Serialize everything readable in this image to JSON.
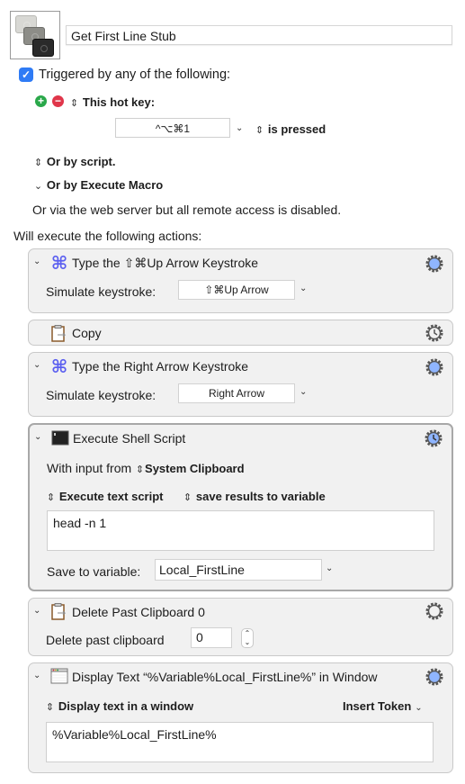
{
  "macro": {
    "icon": "keyboard-keys-icon",
    "name": "Get First Line Stub"
  },
  "trigger": {
    "checkbox_checked": true,
    "label": "Triggered by any of the following:",
    "hotkey_type": "This hot key:",
    "hotkey_value": "^⌥⌘1",
    "hotkey_condition": "is pressed",
    "or_by_script": "Or by script.",
    "or_by_execute_macro": "Or by Execute Macro",
    "web_server_note": "Or via the web server but all remote access is disabled."
  },
  "actions_heading": "Will execute the following actions:",
  "actions": [
    {
      "title": "Type the ⇧⌘Up Arrow Keystroke",
      "icon": "command-key-icon",
      "gear": "gear-blue-icon",
      "field_label": "Simulate keystroke:",
      "field_value": "⇧⌘Up Arrow"
    },
    {
      "title": "Copy",
      "icon": "clipboard-icon",
      "gear": "gear-clock-icon"
    },
    {
      "title": "Type the Right Arrow Keystroke",
      "icon": "command-key-icon",
      "gear": "gear-blue-icon",
      "field_label": "Simulate keystroke:",
      "field_value": "Right Arrow"
    },
    {
      "title": "Execute Shell Script",
      "icon": "terminal-icon",
      "gear": "gear-clock-blue-icon",
      "input_label": "With input from",
      "input_source": "System Clipboard",
      "script_mode": "Execute text script",
      "result_mode": "save results to variable",
      "script": "head -n 1",
      "save_label": "Save to variable:",
      "save_variable": "Local_FirstLine"
    },
    {
      "title": "Delete Past Clipboard 0",
      "icon": "clipboard-icon",
      "gear": "gear-icon",
      "field_label": "Delete past clipboard",
      "field_value": "0"
    },
    {
      "title": "Display Text “%Variable%Local_FirstLine%” in Window",
      "icon": "window-icon",
      "gear": "gear-blue-icon",
      "mode": "Display text in a window",
      "insert_token": "Insert Token",
      "text": "%Variable%Local_FirstLine%"
    }
  ],
  "colors": {
    "accent": "#2f7bf5",
    "gear_blue": "#8fb5ff",
    "command_icon": "#5b5ff0",
    "plus": "#2aa84a",
    "minus": "#e0364a"
  }
}
